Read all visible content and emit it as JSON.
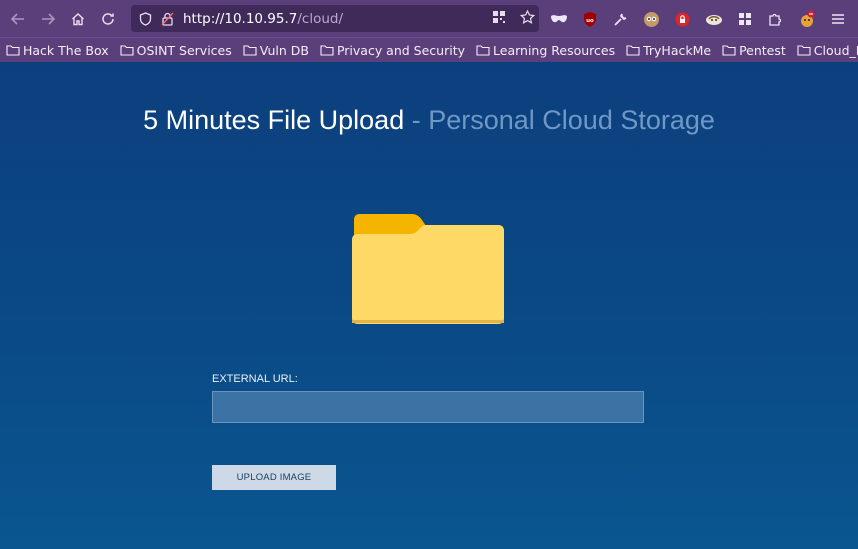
{
  "browser": {
    "url_host": "http://10.10.95.7",
    "url_path": "/cloud/"
  },
  "bookmarks": [
    {
      "label": "Hack The Box"
    },
    {
      "label": "OSINT Services"
    },
    {
      "label": "Vuln DB"
    },
    {
      "label": "Privacy and Security"
    },
    {
      "label": "Learning Resources"
    },
    {
      "label": "TryHackMe"
    },
    {
      "label": "Pentest"
    },
    {
      "label": "Cloud_Pentest"
    }
  ],
  "page": {
    "title_main": "5 Minutes File Upload",
    "title_sep": " - ",
    "title_sub": "Personal Cloud Storage",
    "field_label": "EXTERNAL URL:",
    "field_value": "",
    "upload_label": "UPLOAD IMAGE"
  },
  "colors": {
    "toolbar": "#5b3f7b",
    "page_bg": "#0c3f7e",
    "folder_front": "#ffd966",
    "folder_back": "#f5b400"
  }
}
